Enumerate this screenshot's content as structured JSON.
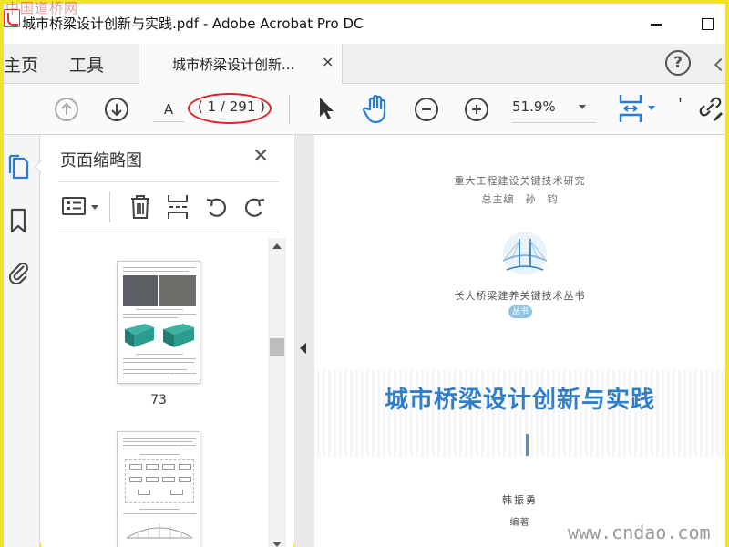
{
  "window": {
    "title": "城市桥梁设计创新与实践.pdf - Adobe Acrobat Pro DC",
    "watermark": "中国道桥网"
  },
  "tabs": {
    "home_label": "主页",
    "tools_label": "工具",
    "document_tab_label": "城市桥梁设计创新...",
    "close_symbol": "×",
    "help_symbol": "?"
  },
  "toolbar": {
    "page_input_value": "A",
    "page_count_text": "( 1 / 291 )",
    "zoom_value": "51.9%",
    "more_symbol": "'"
  },
  "thumbnail_panel": {
    "title": "页面缩略图",
    "close_symbol": "✕",
    "thumbnails": [
      {
        "page_label": "73"
      },
      {
        "page_label": ""
      }
    ]
  },
  "document": {
    "series_research": "重大工程建设关键技术研究",
    "series_editor": "总主编　孙　钧",
    "series_name": "长大桥梁建养关键技术丛书",
    "series_badge": "丛书",
    "book_title": "城市桥梁设计创新与实践",
    "author": "韩振勇",
    "author_role": "编著"
  },
  "watermark_bottom": "www.cndao.com",
  "colors": {
    "frame_border": "#f2e22c",
    "annotation_ellipse": "#e0202a",
    "title_blue": "#2f7ec7",
    "accent_blue": "#2a7bd4",
    "thumb_teal": "#2a9d8f"
  },
  "icons": {
    "prev_page": "arrow-up-circle-icon",
    "next_page": "arrow-down-circle-icon",
    "select": "cursor-arrow-icon",
    "hand": "hand-icon",
    "zoom_out": "minus-circle-icon",
    "zoom_in": "plus-circle-icon",
    "fit": "fit-page-icon",
    "link": "link-edit-icon",
    "pages": "page-thumbnails-icon",
    "bookmarks": "bookmark-icon",
    "attachments": "paperclip-icon",
    "options": "options-list-icon",
    "delete": "trash-icon",
    "extract": "extract-pages-icon",
    "rotate_ccw": "rotate-ccw-icon",
    "rotate_cw": "rotate-cw-icon"
  }
}
